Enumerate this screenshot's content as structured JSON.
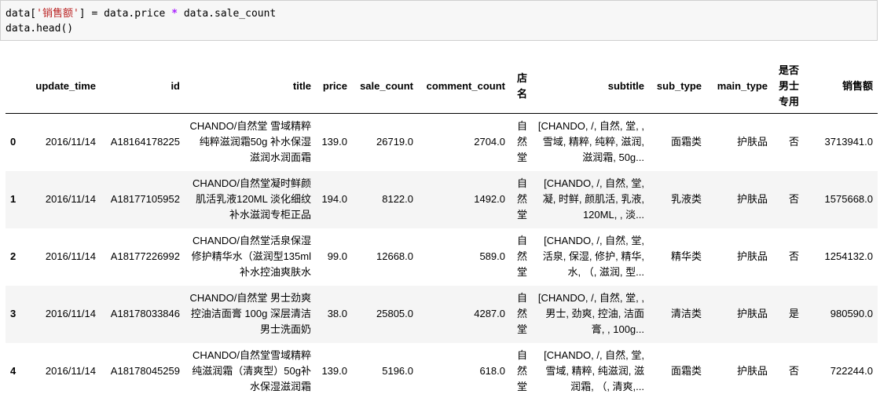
{
  "code_cell": {
    "line1_pre": "data[",
    "line1_str": "'销售额'",
    "line1_mid": "] = data.price ",
    "line1_op": "*",
    "line1_post": " data.sale_count",
    "line2": "data.head()"
  },
  "table": {
    "columns": [
      "",
      "update_time",
      "id",
      "title",
      "price",
      "sale_count",
      "comment_count",
      "店名",
      "subtitle",
      "sub_type",
      "main_type",
      "是否男士专用",
      "销售额"
    ],
    "rows": [
      {
        "index": "0",
        "update_time": "2016/11/14",
        "id": "A18164178225",
        "title": "CHANDO/自然堂 雪域精粹纯粹滋润霜50g 补水保湿 滋润水润面霜",
        "price": "139.0",
        "sale_count": "26719.0",
        "comment_count": "2704.0",
        "shop": "自然堂",
        "subtitle": "[CHANDO, /, 自然, 堂, , 雪域, 精粹, 纯粹, 滋润, 滋润霜, 50g...",
        "sub_type": "面霜类",
        "main_type": "护肤品",
        "male": "否",
        "sales": "3713941.0"
      },
      {
        "index": "1",
        "update_time": "2016/11/14",
        "id": "A18177105952",
        "title": "CHANDO/自然堂凝时鲜颜肌活乳液120ML 淡化细纹补水滋润专柜正品",
        "price": "194.0",
        "sale_count": "8122.0",
        "comment_count": "1492.0",
        "shop": "自然堂",
        "subtitle": "[CHANDO, /, 自然, 堂, 凝, 时鲜, 颜肌活, 乳液, 120ML, , 淡...",
        "sub_type": "乳液类",
        "main_type": "护肤品",
        "male": "否",
        "sales": "1575668.0"
      },
      {
        "index": "2",
        "update_time": "2016/11/14",
        "id": "A18177226992",
        "title": "CHANDO/自然堂活泉保湿修护精华水（滋润型135ml 补水控油爽肤水",
        "price": "99.0",
        "sale_count": "12668.0",
        "comment_count": "589.0",
        "shop": "自然堂",
        "subtitle": "[CHANDO, /, 自然, 堂, 活泉, 保湿, 修护, 精华, 水, （, 滋润, 型...",
        "sub_type": "精华类",
        "main_type": "护肤品",
        "male": "否",
        "sales": "1254132.0"
      },
      {
        "index": "3",
        "update_time": "2016/11/14",
        "id": "A18178033846",
        "title": "CHANDO/自然堂 男士劲爽控油洁面膏 100g 深层清洁 男士洗面奶",
        "price": "38.0",
        "sale_count": "25805.0",
        "comment_count": "4287.0",
        "shop": "自然堂",
        "subtitle": "[CHANDO, /, 自然, 堂, , 男士, 劲爽, 控油, 洁面膏, , 100g...",
        "sub_type": "清洁类",
        "main_type": "护肤品",
        "male": "是",
        "sales": "980590.0"
      },
      {
        "index": "4",
        "update_time": "2016/11/14",
        "id": "A18178045259",
        "title": "CHANDO/自然堂雪域精粹纯滋润霜（清爽型）50g补水保湿滋润霜",
        "price": "139.0",
        "sale_count": "5196.0",
        "comment_count": "618.0",
        "shop": "自然堂",
        "subtitle": "[CHANDO, /, 自然, 堂, 雪域, 精粹, 纯滋润, 滋润霜, （, 清爽,...",
        "sub_type": "面霜类",
        "main_type": "护肤品",
        "male": "否",
        "sales": "722244.0"
      }
    ]
  }
}
